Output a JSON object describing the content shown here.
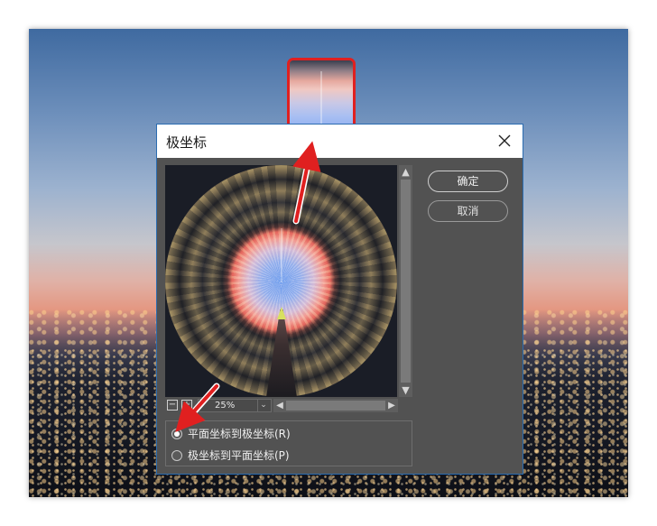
{
  "dialog": {
    "title": "极坐标",
    "ok_label": "确定",
    "cancel_label": "取消",
    "zoom": "25%",
    "options": [
      {
        "label": "平面坐标到极坐标(R)",
        "checked": true
      },
      {
        "label": "极坐标到平面坐标(P)",
        "checked": false
      }
    ]
  },
  "icons": {
    "close": "close-icon",
    "zoom_out": "minus-icon",
    "zoom_in": "plus-icon",
    "annotation": "red-arrow-icon"
  },
  "colors": {
    "dialog_bg": "#525252",
    "accent_red": "#e02020",
    "titlebar_bg": "#ffffff"
  }
}
